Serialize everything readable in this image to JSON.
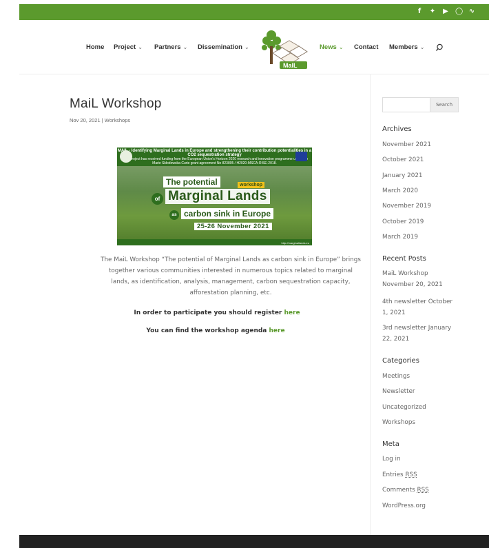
{
  "social_icons": [
    "facebook-icon",
    "twitter-icon",
    "youtube-icon",
    "instagram-icon",
    "rss-icon"
  ],
  "nav": {
    "home": "Home",
    "project": "Project",
    "partners": "Partners",
    "dissemination": "Dissemination",
    "news": "News",
    "contact": "Contact",
    "members": "Members"
  },
  "colors": {
    "accent": "#5b9a2d",
    "footer": "#222222"
  },
  "post": {
    "title": "MaiL Workshop",
    "date": "Nov 20, 2021",
    "separator": " | ",
    "category": "Workshops",
    "banner": {
      "header": "MAIL - Identifying Marginal Lands in Europe and strengthening their contribution potentialities in a CO2 sequestration strategy",
      "funding": "MAIL project has received funding from the European Union's Horizon 2020 research and innovation programme under the Marie Skłodowska-Curie grant agreement No 823805 / H2020-MSCA-RISE-2018.",
      "line1": "The potential",
      "workshop_tag": "workshop",
      "of": "of",
      "line2": "Marginal Lands",
      "as": "as",
      "line3": "carbon sink in Europe",
      "dates": "25-26 November 2021",
      "url": "http://marginallands.eu"
    },
    "body": "The MaiL Workshop “The potential of Marginal Lands as carbon sink in Europe” brings together various communities interested in numerous topics related to marginal lands, as identification, analysis, management, carbon sequestration capacity, afforestation planning, etc.",
    "register_text": "In order to participate you should register ",
    "register_link": "here",
    "agenda_text": "You can find the workshop agenda ",
    "agenda_link": "here"
  },
  "sidebar": {
    "search_button": "Search",
    "archives_title": "Archives",
    "archives": [
      "November 2021",
      "October 2021",
      "January 2021",
      "March 2020",
      "November 2019",
      "October 2019",
      "March 2019"
    ],
    "recent_title": "Recent Posts",
    "recent": [
      "MaiL Workshop November 20, 2021",
      "4th newsletter October 1, 2021",
      "3rd newsletter January 22, 2021"
    ],
    "categories_title": "Categories",
    "categories": [
      "Meetings",
      "Newsletter",
      "Uncategorized",
      "Workshops"
    ],
    "meta_title": "Meta",
    "meta": {
      "login": "Log in",
      "entries": "Entries ",
      "comments": "Comments ",
      "rss": "RSS",
      "wordpress": "WordPress.org"
    }
  }
}
